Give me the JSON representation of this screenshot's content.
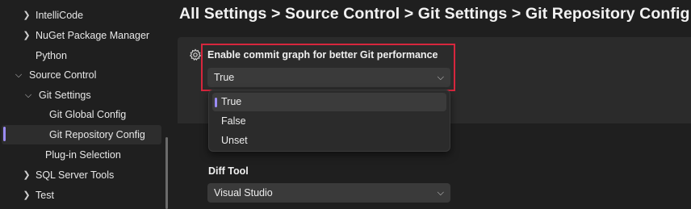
{
  "sidebar": {
    "items": [
      {
        "label": "IntelliCode",
        "expander": "chevron-right-icon"
      },
      {
        "label": "NuGet Package Manager",
        "expander": "chevron-right-icon"
      },
      {
        "label": "Python",
        "expander": ""
      },
      {
        "label": "Source Control",
        "expander": "chevron-down-icon"
      },
      {
        "label": "Git Settings",
        "expander": "chevron-down-icon"
      },
      {
        "label": "Git Global Config",
        "expander": ""
      },
      {
        "label": "Git Repository Config",
        "expander": "",
        "selected": true
      },
      {
        "label": "Plug-in Selection",
        "expander": ""
      },
      {
        "label": "SQL Server Tools",
        "expander": "chevron-right-icon"
      },
      {
        "label": "Test",
        "expander": "chevron-right-icon"
      }
    ]
  },
  "header": {
    "breadcrumb": "All Settings > Source Control > Git Settings > Git Repository Config"
  },
  "commit_graph": {
    "icon": "gear-icon",
    "label": "Enable commit graph for better Git performance",
    "value": "True",
    "options": [
      "True",
      "False",
      "Unset"
    ],
    "highlighted_option": "True"
  },
  "diff_tool": {
    "label": "Diff Tool",
    "value": "Visual Studio"
  },
  "colors": {
    "accent": "#9b8cf5",
    "highlight_border": "#d7263d",
    "background": "#1f1f1f",
    "panel": "#2b2b2b"
  }
}
